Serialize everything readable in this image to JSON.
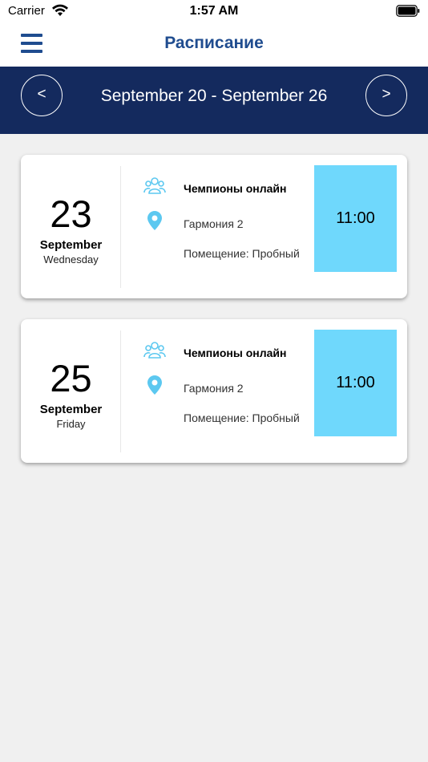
{
  "status_bar": {
    "carrier": "Carrier",
    "time": "1:57 AM"
  },
  "nav": {
    "title": "Расписание",
    "menu_icon": "hamburger-menu-icon",
    "color": "#1f4c8f"
  },
  "week": {
    "label": "September 20 - September 26",
    "prev": "<",
    "next": ">",
    "background": "#142a5e"
  },
  "sessions": [
    {
      "day": "23",
      "month": "September",
      "weekday": "Wednesday",
      "class_name": "Чемпионы онлайн",
      "hall": "Гармония 2",
      "room": "Помещение: Пробный",
      "time": "11:00"
    },
    {
      "day": "25",
      "month": "September",
      "weekday": "Friday",
      "class_name": "Чемпионы онлайн",
      "hall": "Гармония 2",
      "room": "Помещение: Пробный",
      "time": "11:00"
    }
  ],
  "colors": {
    "accent": "#6fd8fc",
    "icon": "#5cc8f0"
  }
}
